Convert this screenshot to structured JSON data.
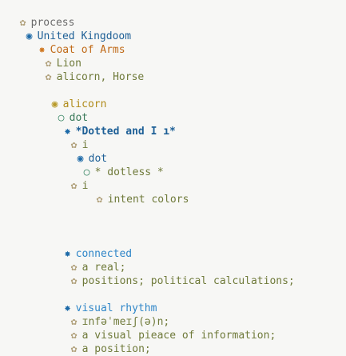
{
  "outline": [
    {
      "bullet": "✿",
      "text": "process"
    },
    {
      "bullet": "◉",
      "text": "United Kingdoom"
    },
    {
      "bullet": "✸",
      "text": "Coat of Arms"
    },
    {
      "bullet": "✿",
      "text": "Lion"
    },
    {
      "bullet": "✿",
      "text": "alicorn, Horse"
    },
    {
      "bullet": "◉",
      "text": "alicorn"
    },
    {
      "bullet": "○",
      "text": "dot"
    },
    {
      "bullet": "✸",
      "text": "*Dotted and I ı*"
    },
    {
      "bullet": "✿",
      "text": "i"
    },
    {
      "bullet": "◉",
      "text": "dot"
    },
    {
      "bullet": "○",
      "text": "* dotless *"
    },
    {
      "bullet": "✿",
      "text": "i"
    },
    {
      "bullet": "✿",
      "text": "intent colors"
    },
    {
      "bullet": "✸",
      "text": "connected"
    },
    {
      "bullet": "✿",
      "text": "a real;"
    },
    {
      "bullet": "✿",
      "text": "positions; political calculations;"
    },
    {
      "bullet": "✸",
      "text": "visual rhythm"
    },
    {
      "bullet": "✿",
      "text": "ɪnfəˈmeɪʃ(ə)n;"
    },
    {
      "bullet": "✿",
      "text": "a visual pieace of information;"
    },
    {
      "bullet": "✿",
      "text": "a position;"
    }
  ]
}
